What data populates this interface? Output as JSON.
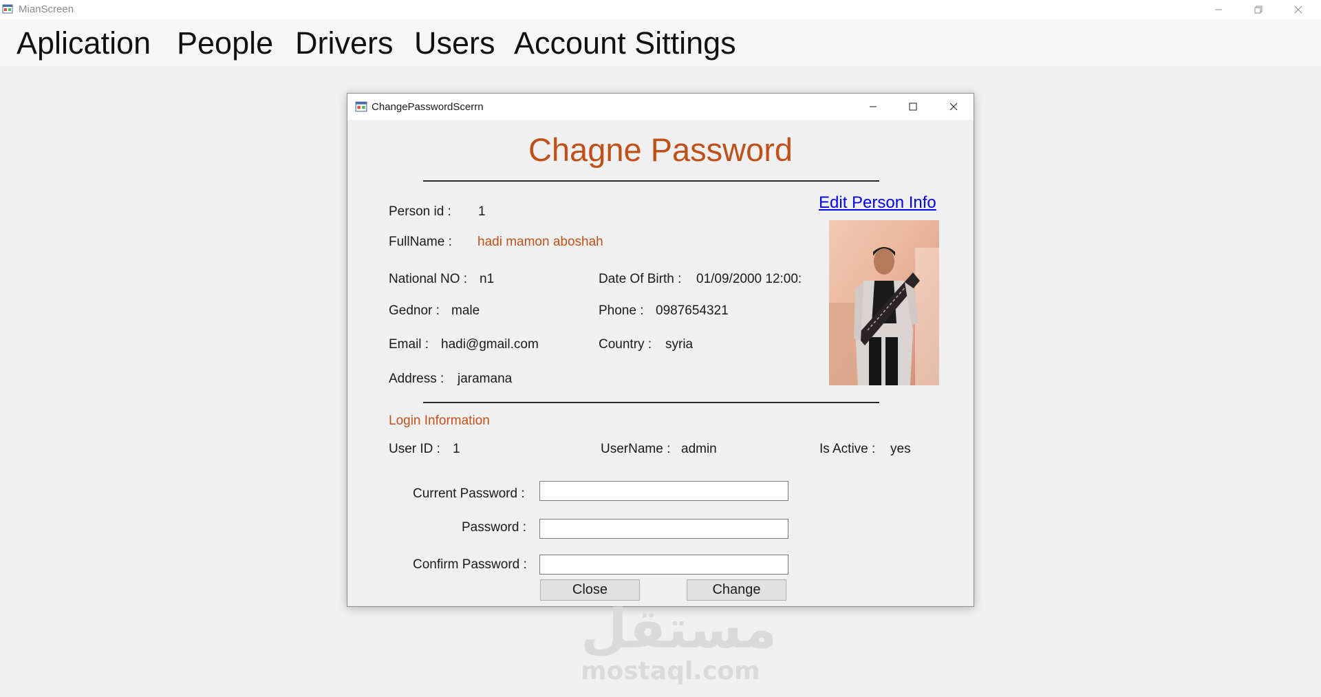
{
  "window": {
    "title": "MianScreen",
    "controls": {
      "minimize_icon": "minimize-icon",
      "restore_icon": "restore-icon",
      "close_icon": "close-icon"
    }
  },
  "menu": {
    "items": [
      "Aplication",
      "People",
      "Drivers",
      "Users",
      "Account Sittings"
    ]
  },
  "dialog": {
    "title": "ChangePasswordScerrn",
    "heading": "Chagne Password",
    "edit_link": "Edit Person Info",
    "person": {
      "person_id_label": "Person id :",
      "person_id": "1",
      "fullname_label": "FullName :",
      "fullname": "hadi mamon aboshah",
      "national_no_label": "National NO :",
      "national_no": "n1",
      "dob_label": "Date Of Birth :",
      "dob": "01/09/2000 12:00:",
      "gender_label": "Gednor :",
      "gender": "male",
      "phone_label": "Phone :",
      "phone": "0987654321",
      "email_label": "Email :",
      "email": "hadi@gmail.com",
      "country_label": "Country :",
      "country": "syria",
      "address_label": "Address :",
      "address": "jaramana"
    },
    "login": {
      "section_title": "Login Information",
      "user_id_label": "User ID :",
      "user_id": "1",
      "username_label": "UserName :",
      "username": "admin",
      "is_active_label": "Is Active :",
      "is_active": "yes"
    },
    "form": {
      "current_password_label": "Current Password :",
      "current_password_value": "",
      "password_label": "Password :",
      "password_value": "",
      "confirm_password_label": "Confirm Password :",
      "confirm_password_value": ""
    },
    "buttons": {
      "close": "Close",
      "change": "Change"
    }
  },
  "watermark": {
    "arabic": "مستقل",
    "latin": "mostaql.com"
  },
  "colors": {
    "accent": "#c0501a",
    "link": "#0000ee",
    "background": "#f0f0f0"
  }
}
